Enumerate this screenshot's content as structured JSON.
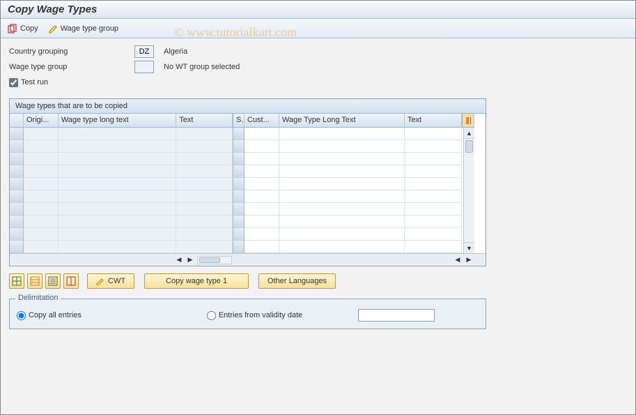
{
  "title": "Copy Wage Types",
  "toolbar": {
    "copy_label": "Copy",
    "wtg_label": "Wage type group"
  },
  "watermark": "© www.tutorialkart.com",
  "form": {
    "country_label": "Country grouping",
    "country_code": "DZ",
    "country_name": "Algeria",
    "wtg_label": "Wage type group",
    "wtg_value": "",
    "wtg_text": "No WT group selected",
    "testrun_label": "Test run",
    "testrun_checked": true
  },
  "table": {
    "caption": "Wage types that are to be copied",
    "left_cols": [
      "Origi...",
      "Wage type long text",
      "Text"
    ],
    "right_cols": [
      "S",
      "Cust...",
      "Wage Type Long Text",
      "Text"
    ],
    "row_count": 10
  },
  "buttons": {
    "cwt_label": "CWT",
    "copy1_label": "Copy wage type 1",
    "other_lang_label": "Other Languages"
  },
  "delimitation": {
    "group_label": "Delimitation",
    "copy_all_label": "Copy all entries",
    "from_date_label": "Entries from validity date",
    "selected": "copy_all",
    "date_value": ""
  }
}
